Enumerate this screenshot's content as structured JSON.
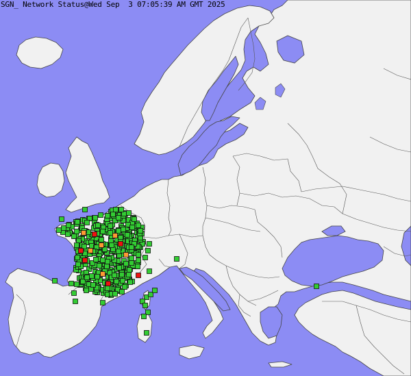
{
  "header": {
    "title": "SGN_ Network Status@Wed Sep  3 07:05:39 AM GMT 2025"
  },
  "colors": {
    "sea": "#8c8cf4",
    "land": "#f1f1f1",
    "border": "#555555",
    "status_ok": "#33cc33",
    "status_warning": "#ff9933",
    "status_down": "#ee1111"
  },
  "stations": {
    "ok_count_approx": 480,
    "warning_count_approx": 6,
    "down_count_approx": 6
  }
}
